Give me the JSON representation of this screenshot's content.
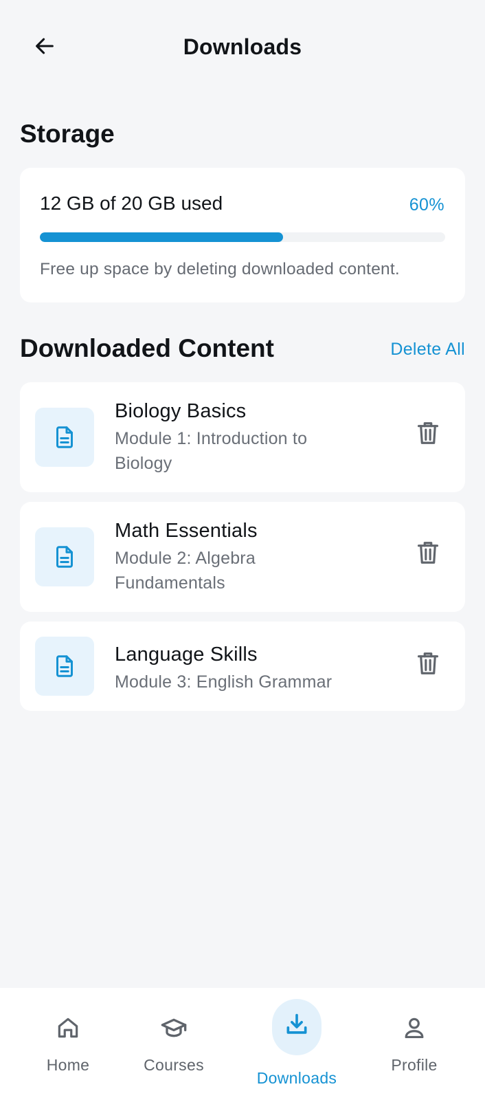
{
  "header": {
    "title": "Downloads"
  },
  "storage": {
    "section_title": "Storage",
    "used_text": "12 GB of 20 GB used",
    "percent_text": "60%",
    "fraction_used": 0.6,
    "hint": "Free up space by deleting downloaded content."
  },
  "content": {
    "section_title": "Downloaded Content",
    "delete_all_label": "Delete All",
    "items": [
      {
        "title": "Biology Basics",
        "subtitle": "Module 1: Introduction to Biology",
        "icon": "document-icon"
      },
      {
        "title": "Math Essentials",
        "subtitle": "Module 2: Algebra Fundamentals",
        "icon": "document-icon"
      },
      {
        "title": "Language Skills",
        "subtitle": "Module 3: English Grammar",
        "icon": "document-icon"
      }
    ]
  },
  "nav": {
    "items": [
      {
        "label": "Home",
        "icon": "home-icon",
        "active": false
      },
      {
        "label": "Courses",
        "icon": "graduation-cap-icon",
        "active": false
      },
      {
        "label": "Downloads",
        "icon": "download-icon",
        "active": true
      },
      {
        "label": "Profile",
        "icon": "person-icon",
        "active": false
      }
    ]
  },
  "colors": {
    "accent": "#1592d3",
    "background": "#f5f6f8",
    "card": "#ffffff",
    "icon_bg": "#e7f3fc"
  }
}
